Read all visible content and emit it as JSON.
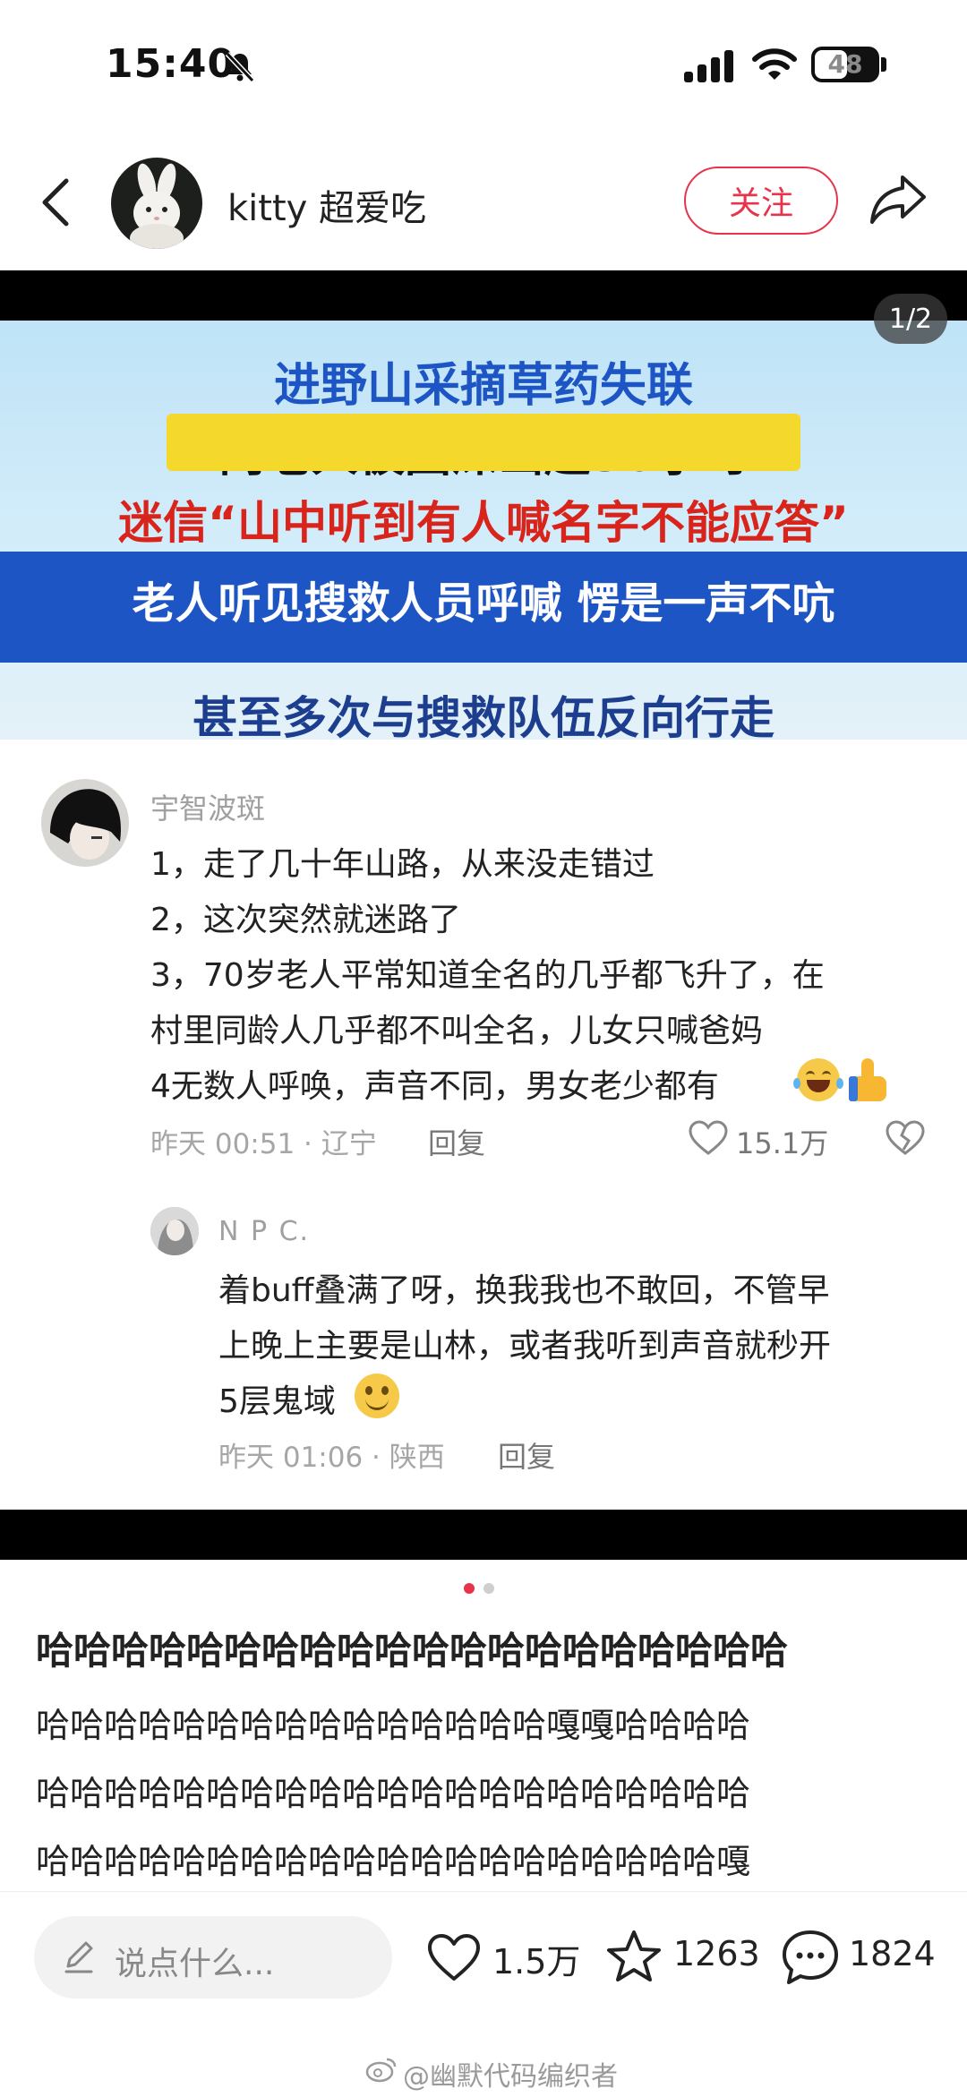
{
  "status_bar": {
    "time": "15:40",
    "battery": "48"
  },
  "header": {
    "username": "kitty 超爱吃",
    "follow_label": "关注"
  },
  "media": {
    "page_indicator": "1/2",
    "banner_lines": [
      "进野山采摘草药失联",
      "两老人被困深山超30小时",
      "迷信“山中听到有人喊名字不能应答”",
      "老人听见搜救人员呼喊 愣是一声不吭",
      "甚至多次与搜救队伍反向行走"
    ],
    "comment": {
      "author": "宇智波斑",
      "lines": [
        "1，走了几十年山路，从来没走错过",
        "2，这次突然就迷路了",
        "3，70岁老人平常知道全名的几乎都飞升了，在",
        "村里同龄人几乎都不叫全名，儿女只喊爸妈",
        "4无数人呼唤，声音不同，男女老少都有"
      ],
      "time_location": "昨天 00:51 · 辽宁",
      "reply_label": "回复",
      "likes": "15.1万"
    },
    "reply": {
      "author": "N P C.",
      "lines": [
        "着buff叠满了呀，换我我也不敢回，不管早",
        "上晚上主要是山林，或者我听到声音就秒开",
        "5层鬼域"
      ],
      "time_location": "昨天 01:06 · 陕西",
      "reply_label": "回复"
    }
  },
  "post": {
    "title": "哈哈哈哈哈哈哈哈哈哈哈哈哈哈哈哈哈哈哈哈",
    "body_lines": [
      "哈哈哈哈哈哈哈哈哈哈哈哈哈哈哈嘎嘎哈哈哈哈",
      "哈哈哈哈哈哈哈哈哈哈哈哈哈哈哈哈哈哈哈哈哈",
      "哈哈哈哈哈哈哈哈哈哈哈哈哈哈哈哈哈哈哈哈嘎"
    ]
  },
  "bottom_bar": {
    "input_placeholder": "说点什么...",
    "likes": "1.5万",
    "favorites": "1263",
    "comments": "1824"
  },
  "watermark": "@幽默代码编织者",
  "colors": {
    "accent": "#e8344b",
    "banner_blue": "#1d55c4",
    "banner_red": "#d9241c"
  }
}
